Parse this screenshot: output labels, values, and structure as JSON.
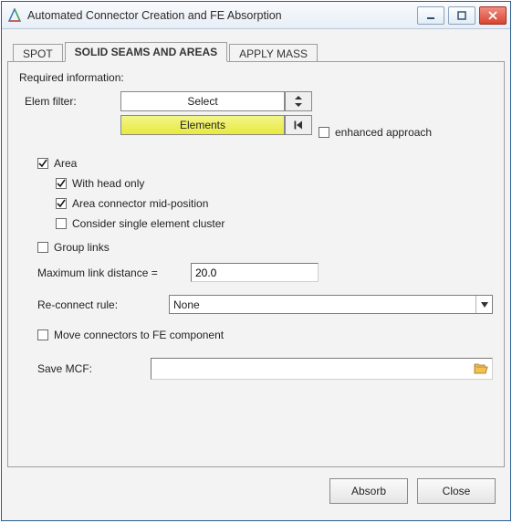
{
  "window": {
    "title": "Automated Connector Creation and FE Absorption"
  },
  "tabs": {
    "spot": "SPOT",
    "solid": "SOLID SEAMS AND AREAS",
    "apply": "APPLY MASS"
  },
  "form": {
    "required": "Required information:",
    "elem_filter_label": "Elem filter:",
    "select_value": "Select",
    "elements_button": "Elements",
    "enhanced_label": "enhanced approach",
    "area_label": "Area",
    "with_head_label": "With head only",
    "mid_pos_label": "Area connector mid-position",
    "single_cluster_label": "Consider single element cluster",
    "group_links_label": "Group links",
    "max_link_label": "Maximum link distance =",
    "max_link_value": "20.0",
    "reconnect_label": "Re-connect rule:",
    "reconnect_value": "None",
    "move_fe_label": "Move connectors to FE component",
    "save_mcf_label": "Save MCF:",
    "save_mcf_value": ""
  },
  "footer": {
    "absorb": "Absorb",
    "close": "Close"
  },
  "checked": {
    "enhanced": false,
    "area": true,
    "with_head": true,
    "mid_pos": true,
    "single_cluster": false,
    "group_links": false,
    "move_fe": false
  }
}
